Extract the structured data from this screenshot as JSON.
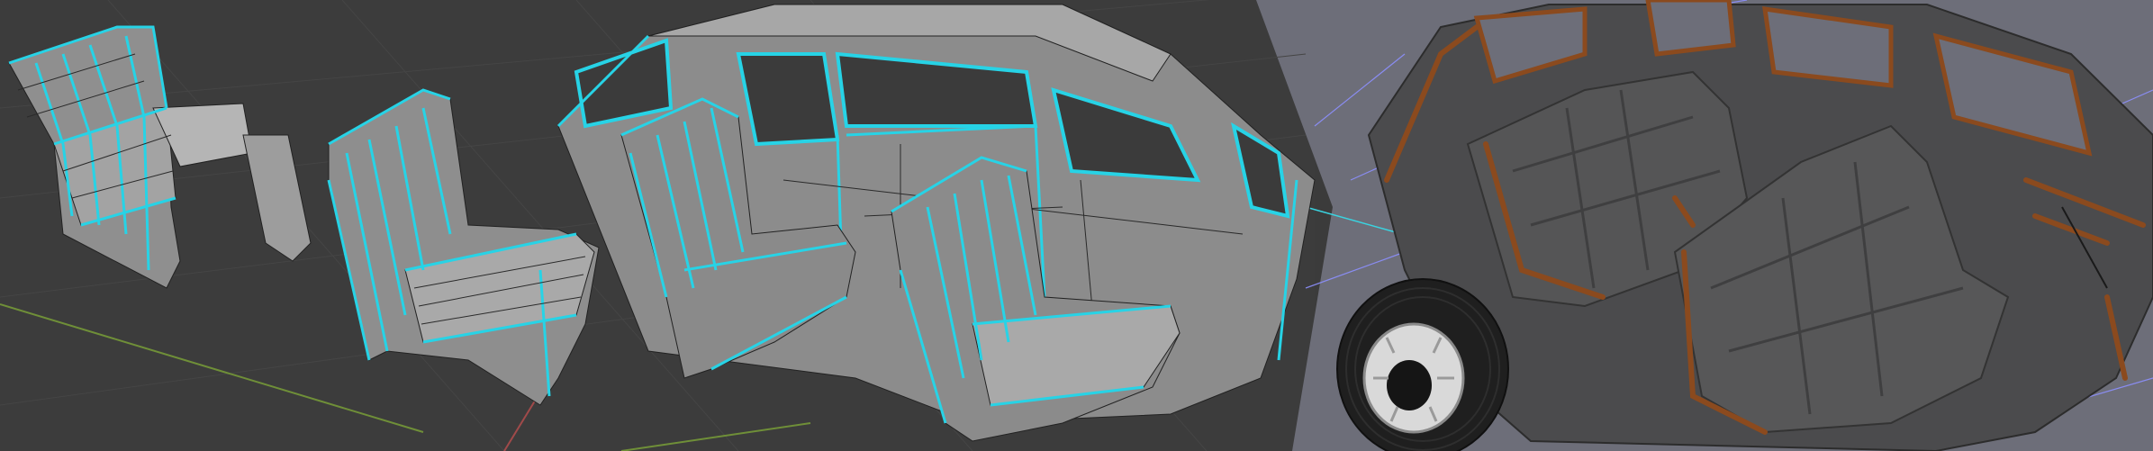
{
  "image": {
    "kind": "3d-modeling-viewport-collage",
    "panels": [
      {
        "name": "viewport-wireframe-panel",
        "background": "#3b3b3b",
        "grid_color": "#474747",
        "edge_highlight": "#27d3e6",
        "mesh_color": "#9a9a9a"
      },
      {
        "name": "viewport-textured-render-panel",
        "background": "#6c6d78",
        "grid_color": "#8a8dff",
        "wood_trim_color": "#8b4a1e",
        "upholstery_color": "#4a4a4a"
      }
    ],
    "axis_colors": {
      "x_axis": "#b84a4a",
      "y_axis": "#7e9f3a"
    }
  }
}
